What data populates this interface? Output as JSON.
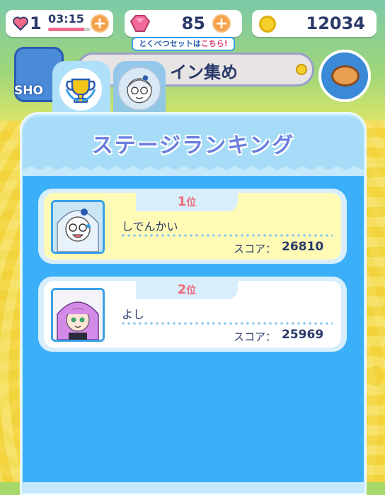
{
  "status": {
    "lives": "1",
    "timer": "03:15",
    "timer_progress": 0.85,
    "gems": "85",
    "coins": "12034",
    "plus": "+",
    "special_tag_prefix": "とくべつセットは",
    "special_tag_link": "こちら!"
  },
  "background": {
    "shop_label": "SHO",
    "coin_event_label": "イン集め"
  },
  "modal": {
    "title": "ステージランキング",
    "rankings": [
      {
        "rank": "1",
        "rank_suffix": "位",
        "name": "しでんかい",
        "score_label": "スコア：",
        "score": "26810"
      },
      {
        "rank": "2",
        "rank_suffix": "位",
        "name": "よし",
        "score_label": "スコア：",
        "score": "25969"
      }
    ]
  },
  "colors": {
    "accent_blue": "#3bb0f8",
    "title_purple": "#6b7fe0",
    "rank_pink": "#f06a7a",
    "first_row_bg": "#fffbb6"
  },
  "icons": [
    "heart-icon",
    "gem-icon",
    "coin-icon",
    "plus-icon",
    "trophy-icon",
    "avatar-tab-icon",
    "food-icon"
  ]
}
